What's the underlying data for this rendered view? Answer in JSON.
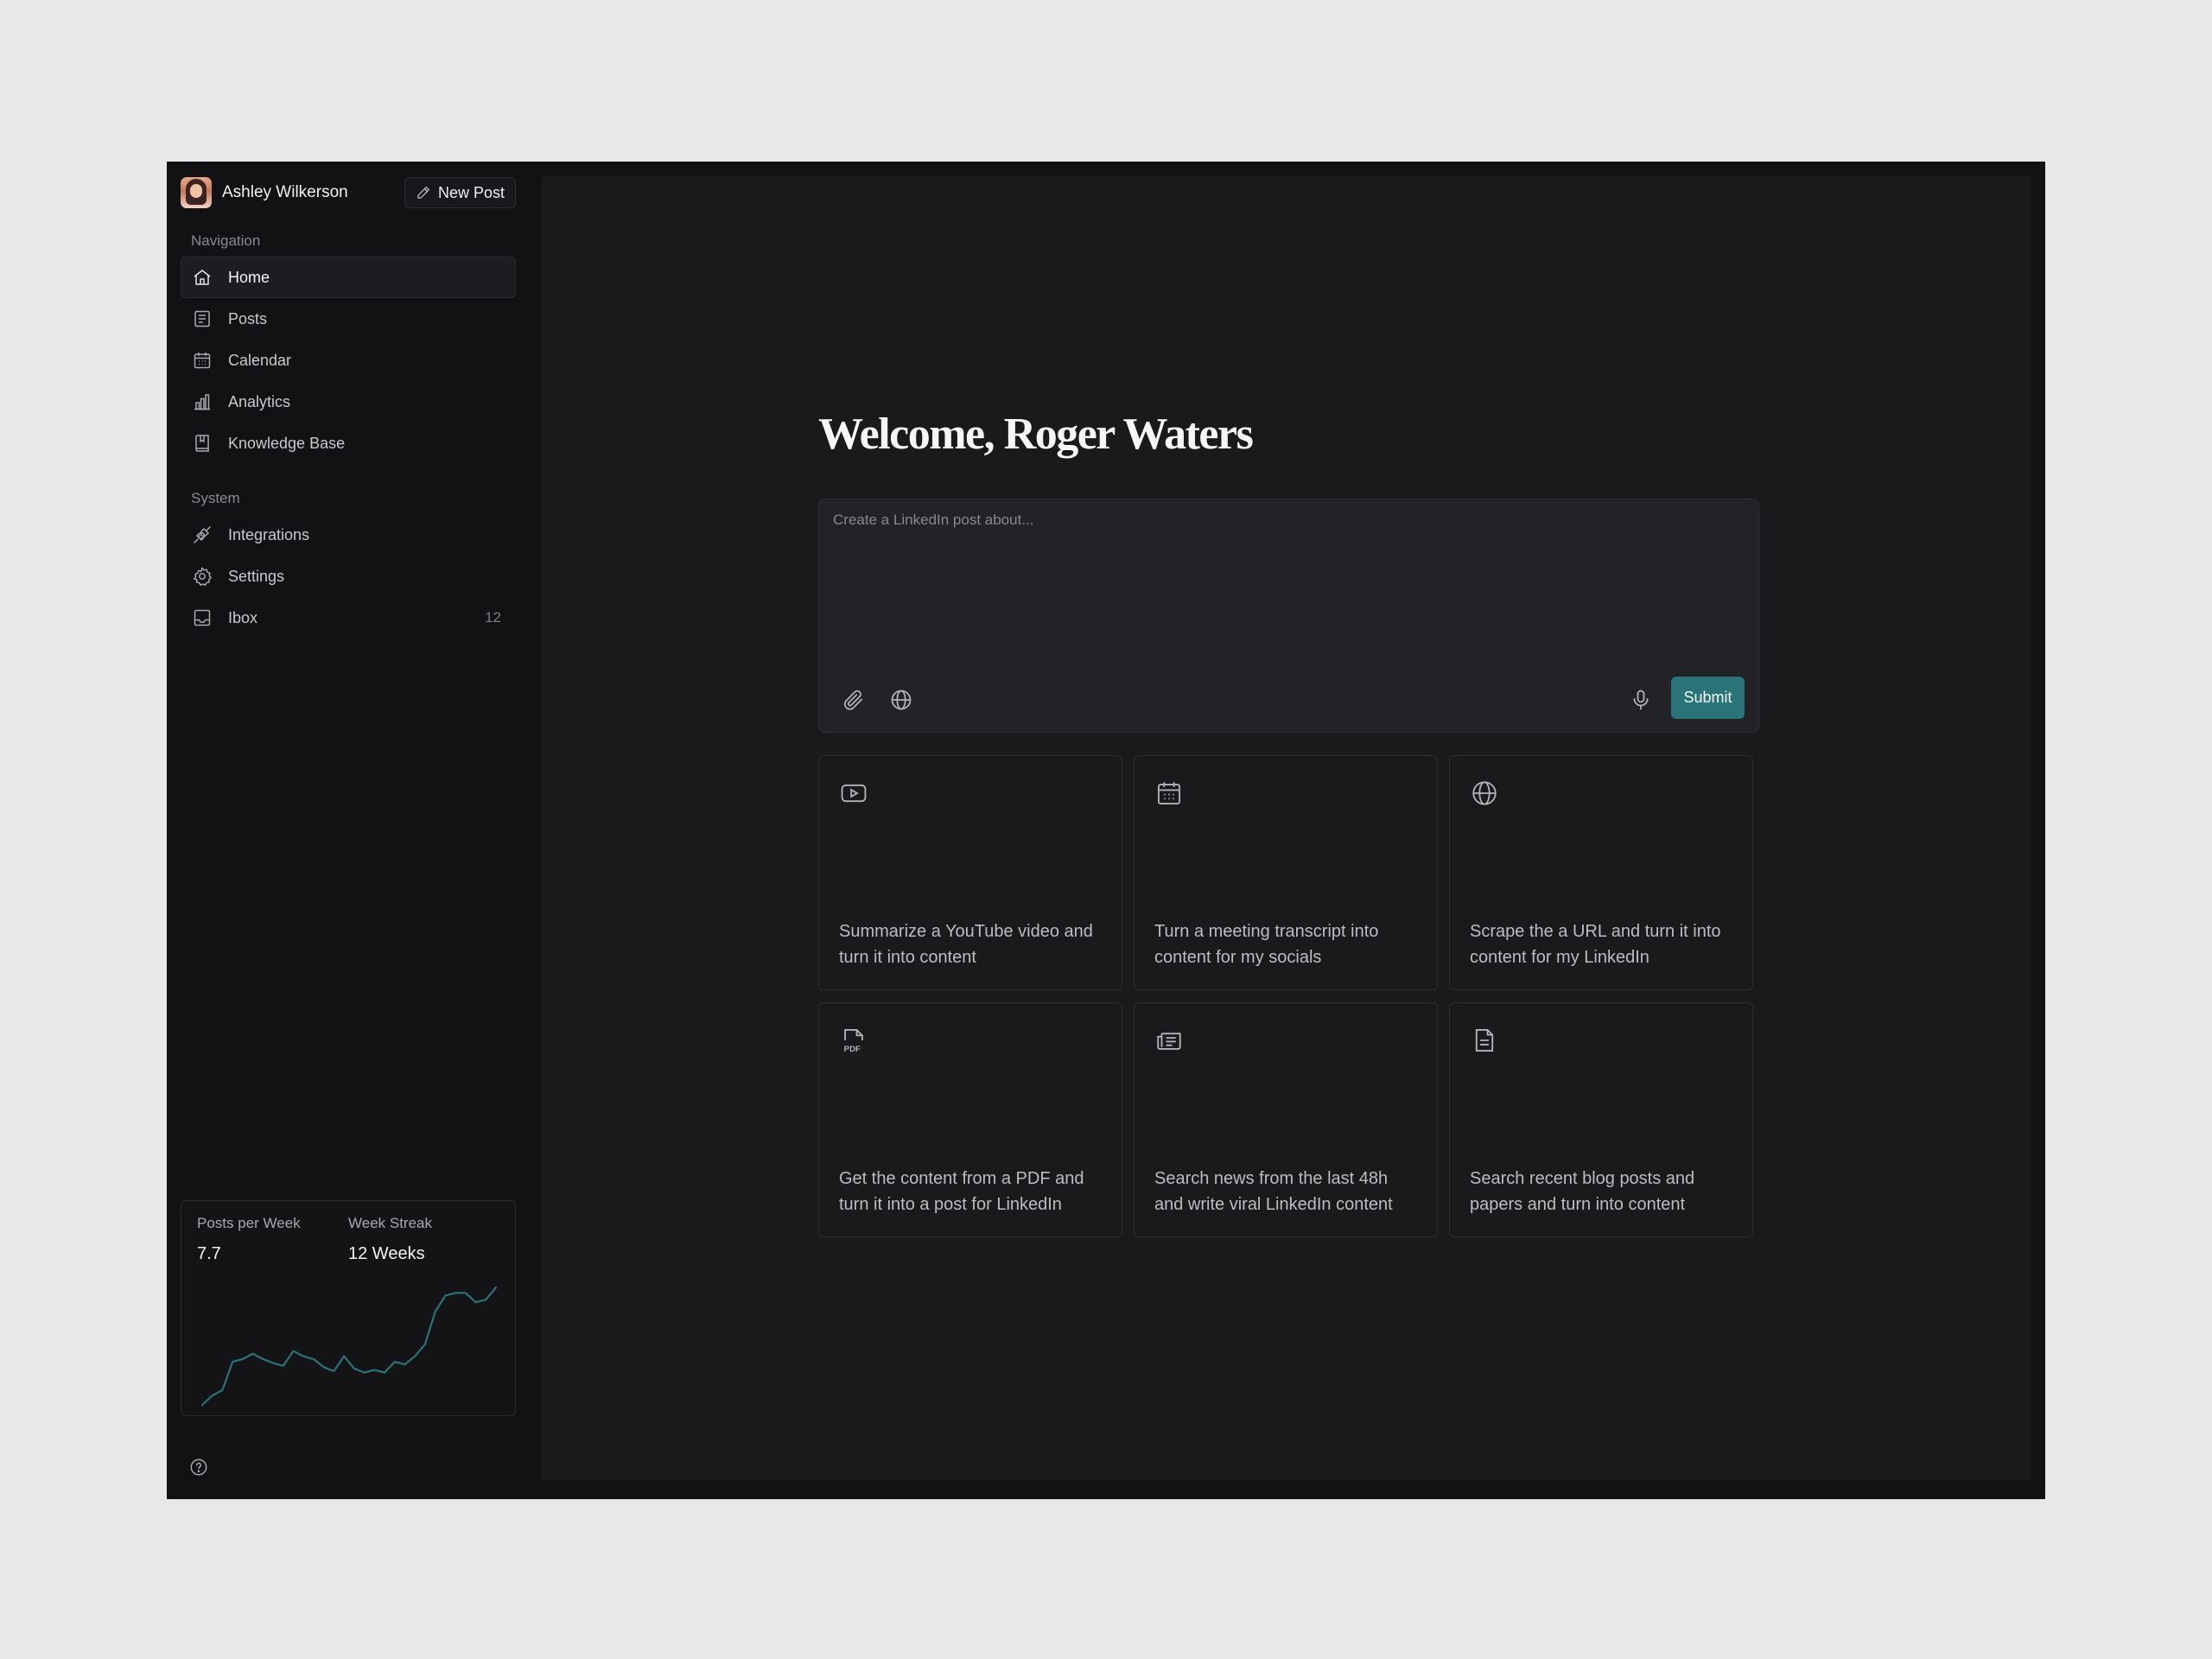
{
  "user": {
    "name": "Ashley Wilkerson"
  },
  "header": {
    "new_post_label": "New Post"
  },
  "navigation": {
    "label": "Navigation",
    "items": [
      {
        "label": "Home",
        "icon": "home-icon"
      },
      {
        "label": "Posts",
        "icon": "posts-icon"
      },
      {
        "label": "Calendar",
        "icon": "calendar-icon"
      },
      {
        "label": "Analytics",
        "icon": "analytics-icon"
      },
      {
        "label": "Knowledge Base",
        "icon": "book-icon"
      }
    ]
  },
  "system": {
    "label": "System",
    "items": [
      {
        "label": "Integrations",
        "icon": "plug-icon"
      },
      {
        "label": "Settings",
        "icon": "gear-icon"
      },
      {
        "label": "Ibox",
        "icon": "inbox-icon",
        "count": "12"
      }
    ]
  },
  "stats": {
    "posts_per_week_label": "Posts per Week",
    "posts_per_week_value": "7.7",
    "week_streak_label": "Week Streak",
    "week_streak_value": "12 Weeks",
    "sparkline": [
      1,
      8,
      12,
      33,
      35,
      39,
      35,
      32,
      30,
      41,
      37,
      35,
      29,
      26,
      37,
      28,
      25,
      27,
      25,
      33,
      31,
      37,
      46,
      70,
      82,
      84,
      84,
      77,
      79,
      88
    ],
    "line_color": "#2a7479"
  },
  "main": {
    "welcome": "Welcome, Roger Waters",
    "composer": {
      "placeholder": "Create a LinkedIn post about...",
      "submit_label": "Submit"
    },
    "cards": [
      {
        "icon": "youtube-icon",
        "text": "Summarize a YouTube video and turn it into content"
      },
      {
        "icon": "calendar-icon",
        "text": "Turn a meeting transcript into content for my socials"
      },
      {
        "icon": "globe-icon",
        "text": "Scrape the a URL and turn it into content for my LinkedIn"
      },
      {
        "icon": "pdf-icon",
        "text": "Get the content from a PDF and turn it into a post for LinkedIn"
      },
      {
        "icon": "newspaper-icon",
        "text": "Search news from the last 48h and write viral LinkedIn content"
      },
      {
        "icon": "document-icon",
        "text": "Search recent blog posts and papers and turn into content"
      }
    ]
  },
  "colors": {
    "accent": "#2a7479",
    "app_bg": "#121114",
    "main_bg": "#1a191c",
    "page_bg": "#e8e7ea"
  }
}
